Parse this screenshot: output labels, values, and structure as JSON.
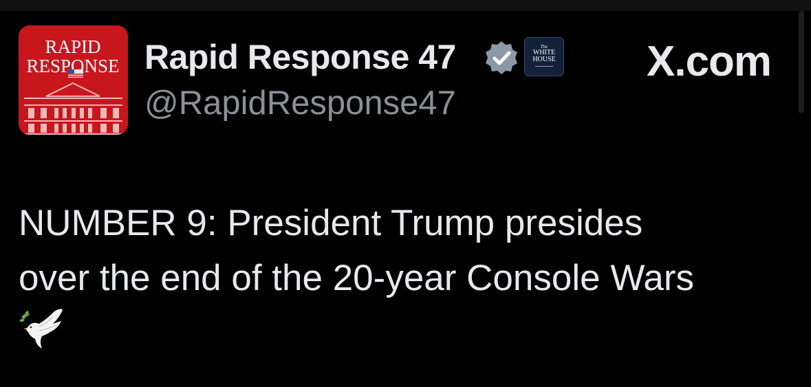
{
  "post": {
    "author": {
      "display_name": "Rapid Response 47",
      "handle": "@RapidResponse47",
      "avatar_text_line1": "RAPID",
      "avatar_text_line2": "RESPONSE",
      "verified_badge_icon": "verified-badge-icon",
      "verified_color": "#8b98a5",
      "affiliate_badge_small": "The",
      "affiliate_badge_line1": "WHITE",
      "affiliate_badge_line2": "HOUSE"
    },
    "source_label": "X.com",
    "text_lines": [
      "NUMBER 9: President Trump presides",
      "over the end of the 20-year Console Wars"
    ],
    "emoji": "dove-with-olive-branch-icon"
  },
  "colors": {
    "background": "#000000",
    "primary_text": "#e7e9ea",
    "secondary_text": "#8b9096",
    "avatar_red": "#c8161d"
  }
}
